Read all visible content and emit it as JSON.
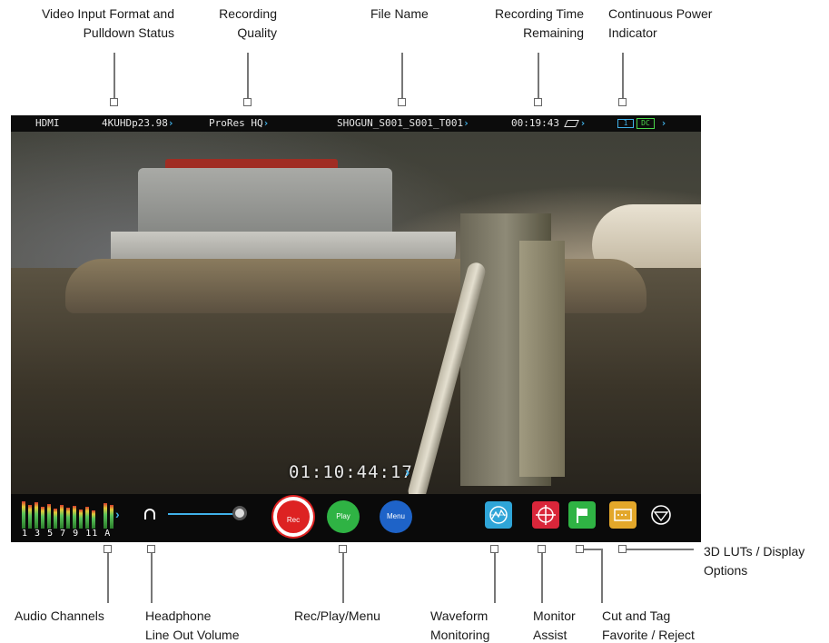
{
  "callouts": {
    "video_input": [
      "Video Input Format and",
      "Pulldown Status"
    ],
    "recording_quality": [
      "Recording",
      "Quality"
    ],
    "file_name": "File Name",
    "recording_time": [
      "Recording Time",
      "Remaining"
    ],
    "power": [
      "Continuous Power",
      "Indicator"
    ],
    "luts": [
      "3D LUTs / Display",
      "Options"
    ],
    "audio": "Audio Channels",
    "headphone": [
      "Headphone",
      "Line Out Volume"
    ],
    "recplay": "Rec/Play/Menu",
    "waveform": [
      "Waveform",
      "Monitoring"
    ],
    "monitor_assist": [
      "Monitor",
      "Assist"
    ],
    "cut_tag": [
      "Cut and Tag",
      "Favorite / Reject"
    ]
  },
  "top_bar": {
    "input": "HDMI",
    "format": "4KUHDp23.98",
    "codec": "ProRes HQ",
    "file": "SHOGUN_S001_S001_T001",
    "time_remaining": "00:19:43",
    "battery": "1",
    "dc": "DC",
    "chevron": "›"
  },
  "timecode": "01:10:44:17",
  "bottom_bar": {
    "channel_labels": "1 3 5 7 9 11 A",
    "rec_label": "Rec",
    "play_label": "Play",
    "menu_label": "Menu",
    "volume_level": 0.9
  },
  "colors": {
    "accent": "#3fb0e8",
    "rec": "#dd2222",
    "play": "#2fb344",
    "menu": "#1e63c8",
    "waveform": "#2fa5d8",
    "assist": "#d9263a",
    "tag": "#e3a72a"
  }
}
